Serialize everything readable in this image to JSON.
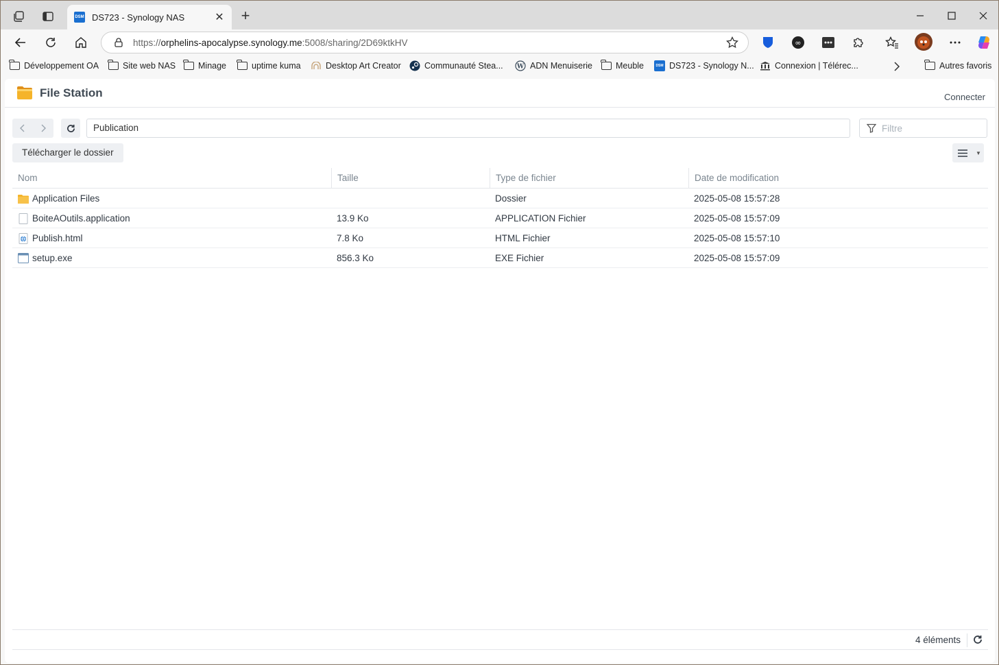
{
  "browser": {
    "tab": {
      "favicon": "DSM",
      "title": "DS723 - Synology NAS"
    },
    "address": {
      "scheme": "https://",
      "host": "orphelins-apocalypse.synology.me",
      "rest": ":5008/sharing/2D69ktkHV"
    },
    "bookmarks": [
      {
        "label": "Développement OA",
        "icon": "folder-icon"
      },
      {
        "label": "Site web NAS",
        "icon": "folder-icon"
      },
      {
        "label": "Minage",
        "icon": "folder-icon"
      },
      {
        "label": "uptime kuma",
        "icon": "folder-icon"
      },
      {
        "label": "Desktop Art Creator",
        "icon": "art-icon"
      },
      {
        "label": "Communauté Stea...",
        "icon": "steam-icon"
      },
      {
        "label": "ADN Menuiserie",
        "icon": "wordpress-icon"
      },
      {
        "label": "Meuble",
        "icon": "folder-icon"
      },
      {
        "label": "DS723 - Synology N...",
        "icon": "dsm-icon"
      },
      {
        "label": "Connexion | Télérec...",
        "icon": "bank-icon"
      }
    ],
    "other_bookmarks": "Autres favoris"
  },
  "app": {
    "title": "File Station",
    "connect": "Connecter",
    "path": "Publication",
    "filter_placeholder": "Filtre",
    "download_button": "Télécharger le dossier",
    "columns": [
      "Nom",
      "Taille",
      "Type de fichier",
      "Date de modification"
    ],
    "rows": [
      {
        "name": "Application Files",
        "size": "",
        "type": "Dossier",
        "date": "2025-05-08 15:57:28",
        "icon": "folder-icon"
      },
      {
        "name": "BoiteAOutils.application",
        "size": "13.9 Ko",
        "type": "APPLICATION Fichier",
        "date": "2025-05-08 15:57:09",
        "icon": "file-icon"
      },
      {
        "name": "Publish.html",
        "size": "7.8 Ko",
        "type": "HTML Fichier",
        "date": "2025-05-08 15:57:10",
        "icon": "html-file-icon"
      },
      {
        "name": "setup.exe",
        "size": "856.3 Ko",
        "type": "EXE Fichier",
        "date": "2025-05-08 15:57:09",
        "icon": "exe-file-icon"
      }
    ],
    "item_count": "4 éléments"
  },
  "colors": {
    "accent": "#1a6fd0",
    "folder": "#f5b42a",
    "header_text": "#414b55"
  }
}
